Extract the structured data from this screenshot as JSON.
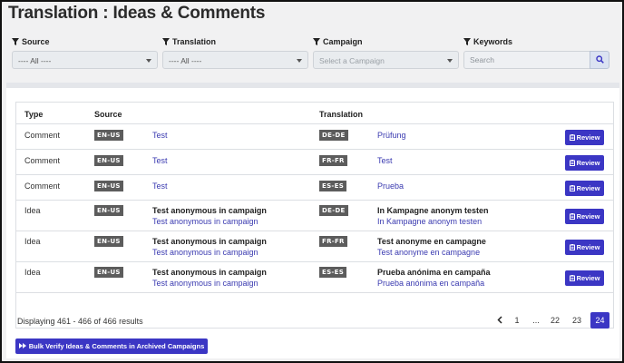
{
  "page": {
    "title": "Translation : Ideas & Comments"
  },
  "filters": {
    "source": {
      "label": "Source",
      "value": "---- All ----"
    },
    "translation": {
      "label": "Translation",
      "value": "---- All ----"
    },
    "campaign": {
      "label": "Campaign",
      "placeholder": "Select a Campaign"
    },
    "keywords": {
      "label": "Keywords",
      "placeholder": "Search"
    }
  },
  "table": {
    "headers": {
      "type": "Type",
      "source": "Source",
      "translation": "Translation"
    },
    "review_label": "Review",
    "rows": [
      {
        "type": "Comment",
        "source_lang": "EN-US",
        "source_title": "",
        "source_text": "Test",
        "target_lang": "DE-DE",
        "target_title": "",
        "target_text": "Prüfung"
      },
      {
        "type": "Comment",
        "source_lang": "EN-US",
        "source_title": "",
        "source_text": "Test",
        "target_lang": "FR-FR",
        "target_title": "",
        "target_text": "Test"
      },
      {
        "type": "Comment",
        "source_lang": "EN-US",
        "source_title": "",
        "source_text": "Test",
        "target_lang": "ES-ES",
        "target_title": "",
        "target_text": "Prueba"
      },
      {
        "type": "Idea",
        "source_lang": "EN-US",
        "source_title": "Test anonymous in campaign",
        "source_text": "Test anonymous in campaign",
        "target_lang": "DE-DE",
        "target_title": "In Kampagne anonym testen",
        "target_text": "In Kampagne anonym testen"
      },
      {
        "type": "Idea",
        "source_lang": "EN-US",
        "source_title": "Test anonymous in campaign",
        "source_text": "Test anonymous in campaign",
        "target_lang": "FR-FR",
        "target_title": "Test anonyme en campagne",
        "target_text": "Test anonyme en campagne"
      },
      {
        "type": "Idea",
        "source_lang": "EN-US",
        "source_title": "Test anonymous in campaign",
        "source_text": "Test anonymous in campaign",
        "target_lang": "ES-ES",
        "target_title": "Prueba anónima en campaña",
        "target_text": "Prueba anónima en campaña"
      }
    ]
  },
  "footer": {
    "results_text": "Displaying 461 - 466 of 466 results"
  },
  "pagination": {
    "prev_icon": "chevron-left",
    "pages": [
      "1",
      "...",
      "22",
      "23",
      "24"
    ],
    "active": "24"
  },
  "bulk_button": {
    "label": "Bulk Verify Ideas & Comments in Archived Campaigns"
  },
  "colors": {
    "accent": "#3b36c4",
    "link": "#3a3ab0",
    "tag": "#5c5c5c"
  }
}
